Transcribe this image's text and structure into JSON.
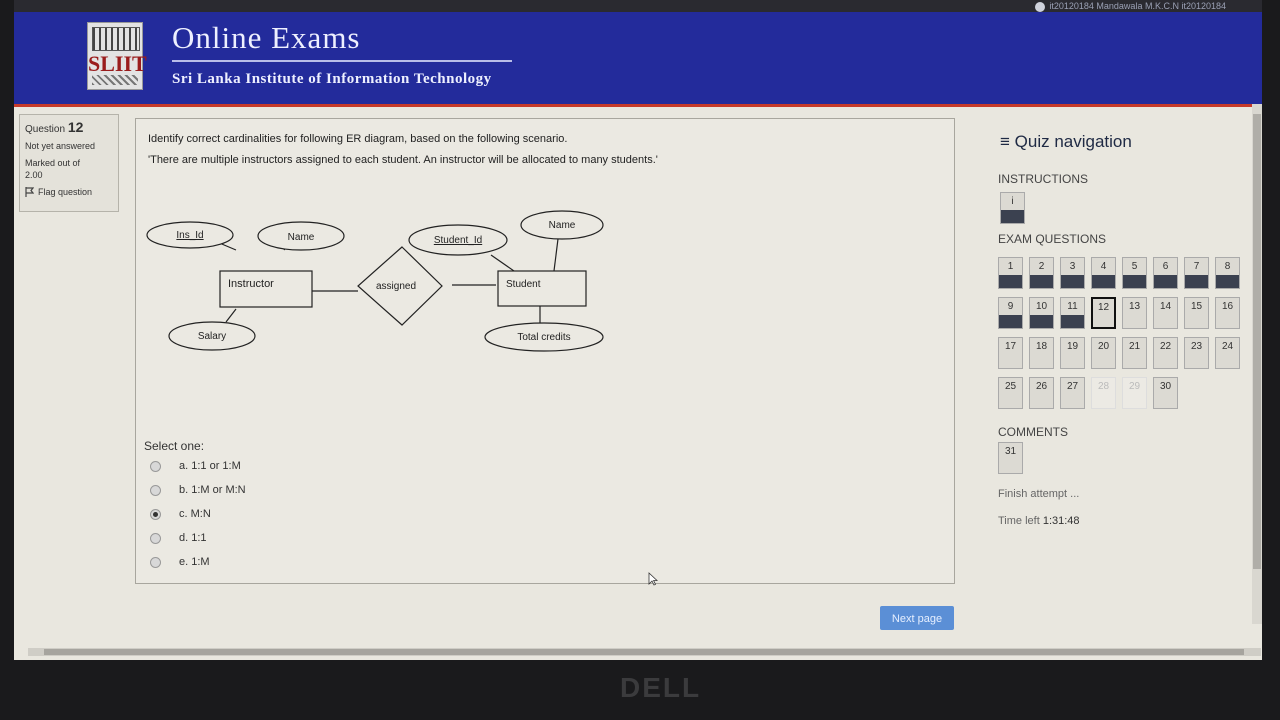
{
  "user": {
    "name": "it20120184 Mandawala M.K.C.N it20120184"
  },
  "header": {
    "title": "Online Exams",
    "subtitle": "Sri Lanka Institute of Information Technology",
    "logo_text": "SLIIT"
  },
  "question_info": {
    "label": "Question",
    "number": "12",
    "status": "Not yet answered",
    "marked": "Marked out of",
    "marks": "2.00",
    "flag": "Flag question"
  },
  "question": {
    "line1": "Identify correct cardinalities for following ER diagram, based on the following scenario.",
    "line2": "'There are multiple instructors assigned to each student. An instructor will be allocated to many students.'"
  },
  "diagram": {
    "ins_id": "Ins_Id",
    "ins_name": "Name",
    "instructor": "Instructor",
    "salary": "Salary",
    "assigned": "assigned",
    "student_id": "Student_Id",
    "stu_name": "Name",
    "student": "Student",
    "total_credits": "Total credits"
  },
  "answer": {
    "prompt": "Select one:",
    "selected_index": 2,
    "options": [
      "a. 1:1 or 1:M",
      "b. 1:M or M:N",
      "c. M:N",
      "d. 1:1",
      "e. 1:M"
    ]
  },
  "navigation": {
    "title": "Quiz navigation",
    "instructions_label": "INSTRUCTIONS",
    "instruction_tile": "i",
    "exam_label": "EXAM QUESTIONS",
    "questions": [
      "1",
      "2",
      "3",
      "4",
      "5",
      "6",
      "7",
      "8",
      "9",
      "10",
      "11",
      "12",
      "13",
      "14",
      "15",
      "16",
      "17",
      "18",
      "19",
      "20",
      "21",
      "22",
      "23",
      "24",
      "25",
      "26",
      "27",
      "28",
      "29",
      "30"
    ],
    "current_question": "12",
    "answered_questions": [
      "1",
      "2",
      "3",
      "4",
      "5",
      "6",
      "7",
      "8",
      "9",
      "10",
      "11"
    ],
    "faded_questions": [
      "28",
      "29"
    ],
    "comments_label": "COMMENTS",
    "comments_tile": "31",
    "finish": "Finish attempt ...",
    "time_label": "Time left",
    "time_value": "1:31:48"
  },
  "next_button": "Next page",
  "monitor_brand": "DELL"
}
